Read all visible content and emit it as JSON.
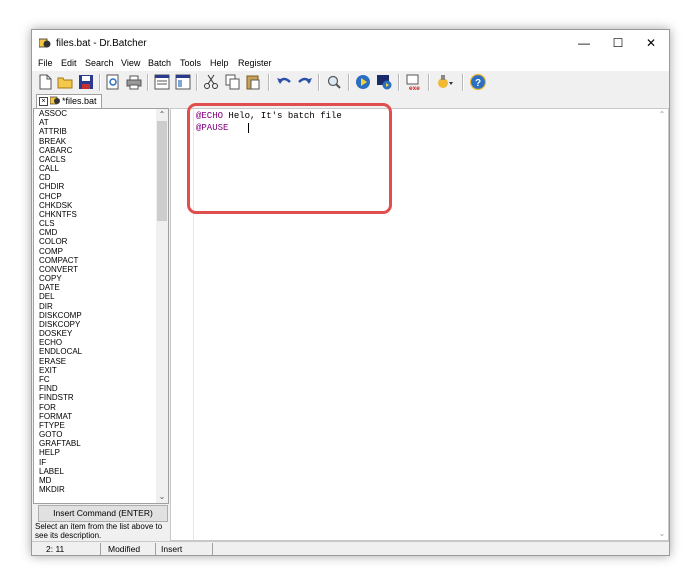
{
  "window": {
    "title": "files.bat - Dr.Batcher",
    "minimize": "—",
    "maximize": "☐",
    "close": "✕"
  },
  "menu": [
    "File",
    "Edit",
    "Search",
    "View",
    "Batch",
    "Tools",
    "Help",
    "Register"
  ],
  "toolbar": {
    "icons": [
      "new-file-icon",
      "open-folder-icon",
      "save-icon",
      "print-preview-icon",
      "print-icon",
      "view-mode-icon",
      "view-mode-2-icon",
      "cut-icon",
      "copy-icon",
      "paste-icon",
      "undo-icon",
      "redo-icon",
      "find-icon",
      "run-icon",
      "run-window-icon",
      "compile-exe-icon",
      "plugins-icon",
      "help-icon"
    ],
    "exe_label": "exe"
  },
  "tab": {
    "label": "*files.bat"
  },
  "commands": [
    "ASSOC",
    "AT",
    "ATTRIB",
    "BREAK",
    "CABARC",
    "CACLS",
    "CALL",
    "CD",
    "CHDIR",
    "CHCP",
    "CHKDSK",
    "CHKNTFS",
    "CLS",
    "CMD",
    "COLOR",
    "COMP",
    "COMPACT",
    "CONVERT",
    "COPY",
    "DATE",
    "DEL",
    "DIR",
    "DISKCOMP",
    "DISKCOPY",
    "DOSKEY",
    "ECHO",
    "ENDLOCAL",
    "ERASE",
    "EXIT",
    "FC",
    "FIND",
    "FINDSTR",
    "FOR",
    "FORMAT",
    "FTYPE",
    "GOTO",
    "GRAFTABL",
    "HELP",
    "IF",
    "LABEL",
    "MD",
    "MKDIR"
  ],
  "insert_button": "Insert Command (ENTER)",
  "description": "Select an item from the list above to see its description.",
  "editor": {
    "line1_kw": "@ECHO",
    "line1_rest": " Helo, It's batch file",
    "line2_kw": "@PAUSE"
  },
  "status": {
    "position": "2: 11",
    "modified": "Modified",
    "mode": "Insert"
  },
  "colors": {
    "keyword": "#800080",
    "highlight": "#e14e4e"
  }
}
